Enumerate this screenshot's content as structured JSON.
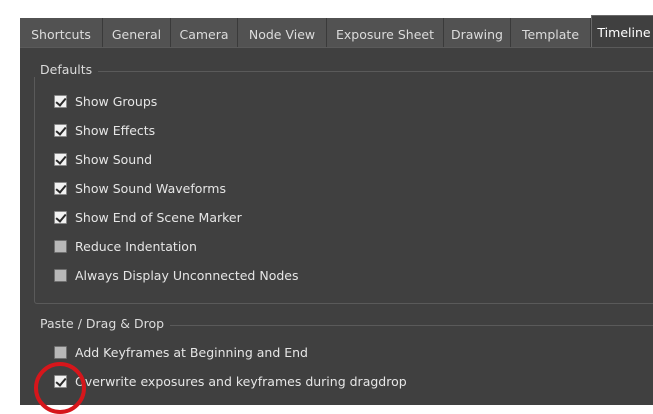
{
  "tabs": [
    "Shortcuts",
    "General",
    "Camera",
    "Node View",
    "Exposure Sheet",
    "Drawing",
    "Template",
    "Timeline"
  ],
  "active_tab": "Timeline",
  "defaults": {
    "title": "Defaults",
    "options": [
      {
        "label": "Show Groups",
        "checked": true
      },
      {
        "label": "Show Effects",
        "checked": true
      },
      {
        "label": "Show Sound",
        "checked": true
      },
      {
        "label": "Show Sound Waveforms",
        "checked": true
      },
      {
        "label": "Show End of Scene Marker",
        "checked": true
      },
      {
        "label": "Reduce Indentation",
        "checked": false
      },
      {
        "label": "Always Display Unconnected Nodes",
        "checked": false
      }
    ]
  },
  "paste_drag_drop": {
    "title": "Paste / Drag  & Drop",
    "options": [
      {
        "label": "Add Keyframes at Beginning and End",
        "checked": false
      },
      {
        "label": "Overwrite exposures and keyframes during dragdrop",
        "checked": true
      }
    ]
  },
  "colors": {
    "annotation": "#d6161b",
    "panel": "#404040"
  }
}
